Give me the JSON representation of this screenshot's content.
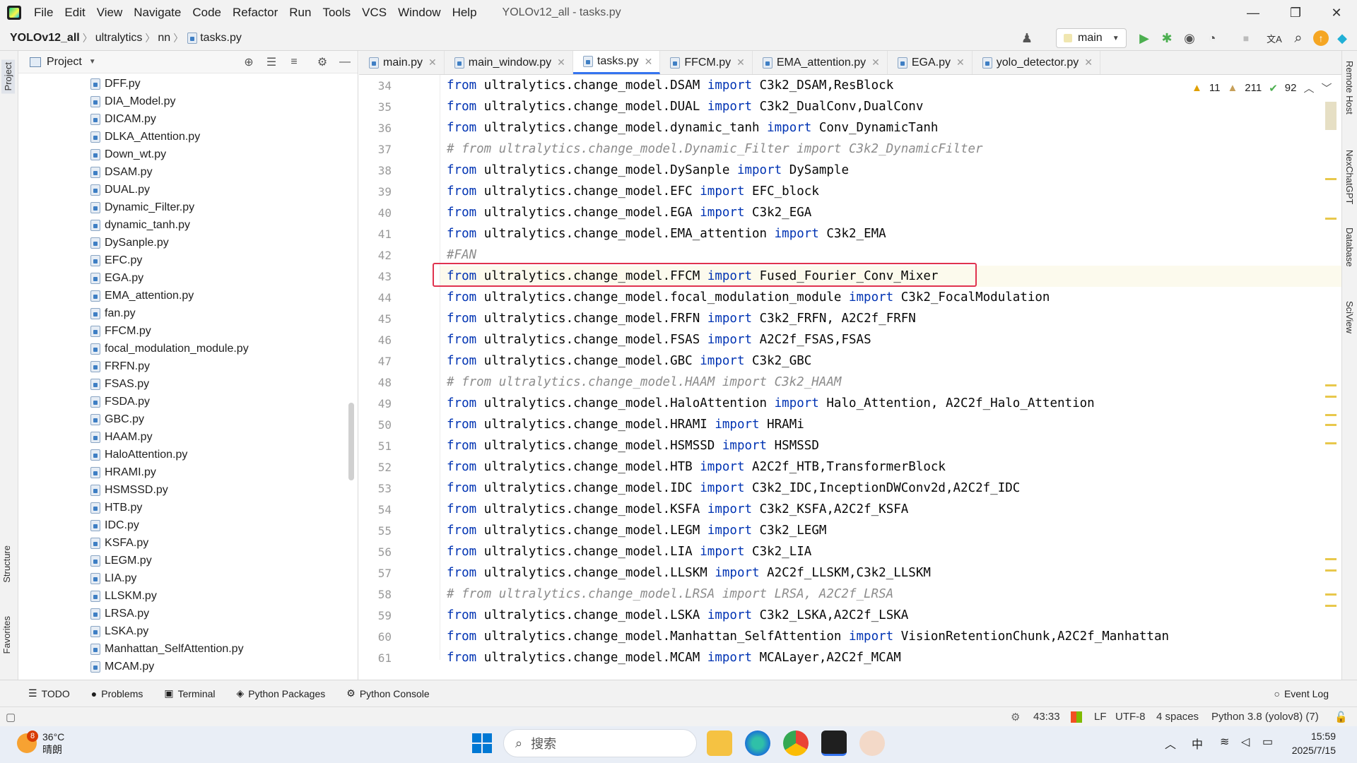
{
  "window": {
    "menu": [
      "File",
      "Edit",
      "View",
      "Navigate",
      "Code",
      "Refactor",
      "Run",
      "Tools",
      "VCS",
      "Window",
      "Help"
    ],
    "title": "YOLOv12_all - tasks.py",
    "minimize": "—",
    "restore": "❐",
    "close": "✕"
  },
  "breadcrumb": {
    "project": "YOLOv12_all",
    "dir1": "ultralytics",
    "dir2": "nn",
    "file": "tasks.py",
    "sep": "〉"
  },
  "toolbar": {
    "run_config": "main",
    "user_icon": "user-icon",
    "run_icon": "▶",
    "debug_icon": "✱",
    "coverage_icon": "◉",
    "profile_icon": "◔",
    "stop_icon": "■",
    "translate_icon": "文A",
    "search_icon": "⌕",
    "update_icon": "↑",
    "plugin_icon": "◆"
  },
  "project_panel": {
    "title": "Project",
    "files": [
      "DFF.py",
      "DIA_Model.py",
      "DICAM.py",
      "DLKA_Attention.py",
      "Down_wt.py",
      "DSAM.py",
      "DUAL.py",
      "Dynamic_Filter.py",
      "dynamic_tanh.py",
      "DySanple.py",
      "EFC.py",
      "EGA.py",
      "EMA_attention.py",
      "fan.py",
      "FFCM.py",
      "focal_modulation_module.py",
      "FRFN.py",
      "FSAS.py",
      "FSDA.py",
      "GBC.py",
      "HAAM.py",
      "HaloAttention.py",
      "HRAMI.py",
      "HSMSSD.py",
      "HTB.py",
      "IDC.py",
      "KSFA.py",
      "LEGM.py",
      "LIA.py",
      "LLSKM.py",
      "LRSA.py",
      "LSKA.py",
      "Manhattan_SelfAttention.py",
      "MCAM.py"
    ]
  },
  "tabs": [
    {
      "label": "main.py",
      "active": false
    },
    {
      "label": "main_window.py",
      "active": false
    },
    {
      "label": "tasks.py",
      "active": true
    },
    {
      "label": "FFCM.py",
      "active": false
    },
    {
      "label": "EMA_attention.py",
      "active": false
    },
    {
      "label": "EGA.py",
      "active": false
    },
    {
      "label": "yolo_detector.py",
      "active": false
    }
  ],
  "inspection": {
    "warnings": "11",
    "weak_warnings": "211",
    "ok": "92"
  },
  "code": [
    {
      "n": "34",
      "mod": "DSAM",
      "imp": "C3k2_DSAM,ResBlock",
      "comment": false
    },
    {
      "n": "35",
      "mod": "DUAL",
      "imp": "C3k2_DualConv,DualConv",
      "comment": false
    },
    {
      "n": "36",
      "mod": "dynamic_tanh",
      "imp": "Conv_DynamicTanh",
      "comment": false
    },
    {
      "n": "37",
      "text": "# from ultralytics.change_model.Dynamic_Filter import C3k2_DynamicFilter",
      "comment": true
    },
    {
      "n": "38",
      "mod": "DySanple",
      "imp": "DySample",
      "comment": false
    },
    {
      "n": "39",
      "mod": "EFC",
      "imp": "EFC_block",
      "comment": false
    },
    {
      "n": "40",
      "mod": "EGA",
      "imp": "C3k2_EGA",
      "comment": false
    },
    {
      "n": "41",
      "mod": "EMA_attention",
      "imp": "C3k2_EMA",
      "comment": false
    },
    {
      "n": "42",
      "text": "#FAN",
      "comment": true
    },
    {
      "n": "43",
      "mod": "FFCM",
      "imp": "Fused_Fourier_Conv_Mixer",
      "comment": false
    },
    {
      "n": "44",
      "mod": "focal_modulation_module",
      "imp": "C3k2_FocalModulation",
      "comment": false
    },
    {
      "n": "45",
      "mod": "FRFN",
      "imp": "C3k2_FRFN, A2C2f_FRFN",
      "comment": false
    },
    {
      "n": "46",
      "mod": "FSAS",
      "imp": "A2C2f_FSAS,FSAS",
      "comment": false
    },
    {
      "n": "47",
      "mod": "GBC",
      "imp": "C3k2_GBC",
      "comment": false
    },
    {
      "n": "48",
      "text": "# from ultralytics.change_model.HAAM import C3k2_HAAM",
      "comment": true
    },
    {
      "n": "49",
      "mod": "HaloAttention",
      "imp": "Halo_Attention, A2C2f_Halo_Attention",
      "comment": false
    },
    {
      "n": "50",
      "mod": "HRAMI",
      "imp": "HRAMi",
      "comment": false
    },
    {
      "n": "51",
      "mod": "HSMSSD",
      "imp": "HSMSSD",
      "comment": false
    },
    {
      "n": "52",
      "mod": "HTB",
      "imp": "A2C2f_HTB,TransformerBlock",
      "comment": false
    },
    {
      "n": "53",
      "mod": "IDC",
      "imp": "C3k2_IDC,InceptionDWConv2d,A2C2f_IDC",
      "comment": false
    },
    {
      "n": "54",
      "mod": "KSFA",
      "imp": "C3k2_KSFA,A2C2f_KSFA",
      "comment": false
    },
    {
      "n": "55",
      "mod": "LEGM",
      "imp": "C3k2_LEGM",
      "comment": false
    },
    {
      "n": "56",
      "mod": "LIA",
      "imp": "C3k2_LIA",
      "comment": false
    },
    {
      "n": "57",
      "mod": "LLSKM",
      "imp": "A2C2f_LLSKM,C3k2_LLSKM",
      "comment": false
    },
    {
      "n": "58",
      "text": "# from ultralytics.change_model.LRSA import LRSA, A2C2f_LRSA",
      "comment": true
    },
    {
      "n": "59",
      "mod": "LSKA",
      "imp": "C3k2_LSKA,A2C2f_LSKA",
      "comment": false
    },
    {
      "n": "60",
      "mod": "Manhattan_SelfAttention",
      "imp": "VisionRetentionChunk,A2C2f_Manhattan",
      "comment": false
    },
    {
      "n": "61",
      "mod": "MCAM",
      "imp": "MCALayer,A2C2f_MCAM",
      "comment": false
    }
  ],
  "code_keywords": {
    "from": "from",
    "import": "import",
    "prefix": "ultralytics.change_model."
  },
  "right_tabs": [
    "Remote Host",
    "NexChatGPT",
    "Database",
    "SciView"
  ],
  "left_tabs": [
    "Project",
    "Structure",
    "Favorites"
  ],
  "bottom_tools": [
    "TODO",
    "Problems",
    "Terminal",
    "Python Packages",
    "Python Console"
  ],
  "event_log": "Event Log",
  "status": {
    "position": "43:33",
    "line_sep": "LF",
    "encoding": "UTF-8",
    "indent": "4 spaces",
    "interpreter": "Python 3.8 (yolov8) (7)"
  },
  "taskbar": {
    "weather_temp": "36°C",
    "weather_desc": "晴朗",
    "weather_badge": "8",
    "search_placeholder": "搜索",
    "ime": "中",
    "time": "15:59",
    "date": "2025/7/15"
  },
  "colors": {
    "keyword": "#0033b3",
    "comment": "#8c8c8c",
    "highlight_box": "#e0334f",
    "accent": "#3574f0"
  }
}
